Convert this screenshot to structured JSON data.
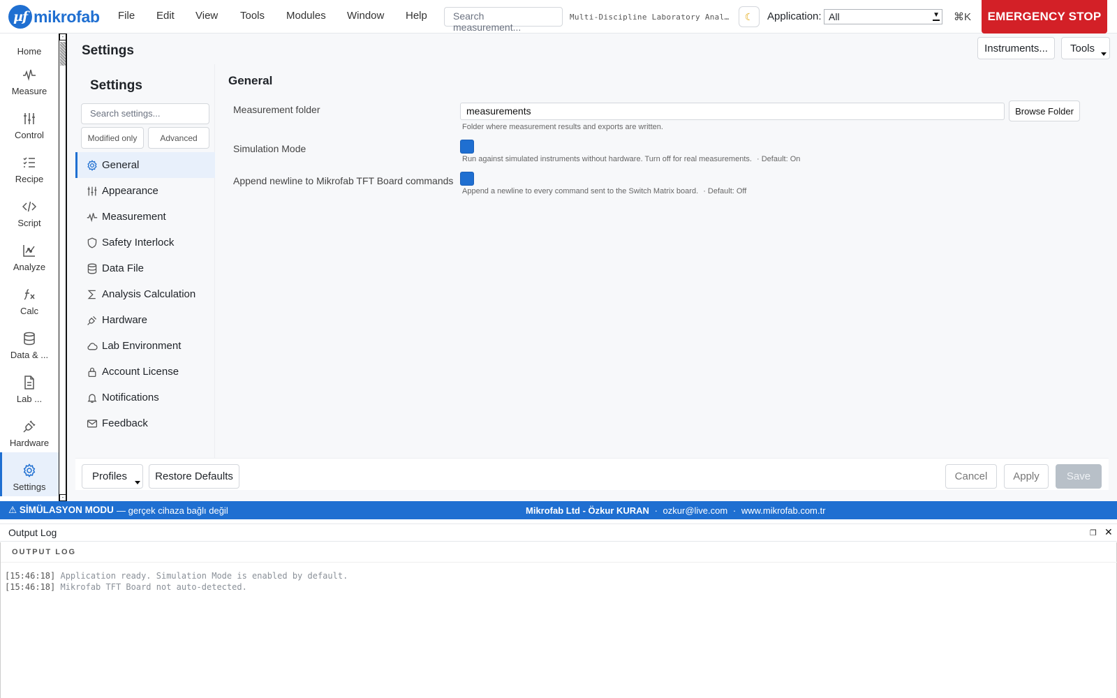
{
  "app": {
    "logo_mark": "µf",
    "logo_text": "mikrofab",
    "title": "Multi-Discipline Laboratory Analysis"
  },
  "menu": [
    "File",
    "Edit",
    "View",
    "Tools",
    "Modules",
    "Window",
    "Help"
  ],
  "search": {
    "placeholder": "Search measurement..."
  },
  "theme_icon": "moon-icon",
  "application": {
    "label": "Application:",
    "value": "All"
  },
  "shortcut": "⌘K",
  "emergency_stop": "EMERGENCY STOP",
  "rail": [
    {
      "label": "Home",
      "icon": "home-icon"
    },
    {
      "label": "Measure",
      "icon": "waveform-icon"
    },
    {
      "label": "Control",
      "icon": "sliders-icon"
    },
    {
      "label": "Recipe",
      "icon": "list-icon"
    },
    {
      "label": "Script",
      "icon": "code-icon"
    },
    {
      "label": "Analyze",
      "icon": "chart-icon"
    },
    {
      "label": "Calc",
      "icon": "function-icon"
    },
    {
      "label": "Data & ...",
      "icon": "database-icon"
    },
    {
      "label": "Lab ...",
      "icon": "document-icon"
    },
    {
      "label": "Hardware",
      "icon": "plug-icon"
    },
    {
      "label": "Settings",
      "icon": "gear-icon",
      "active": true
    }
  ],
  "page": {
    "title": "Settings",
    "instruments_button": "Instruments...",
    "tools_button": "Tools"
  },
  "settings": {
    "title": "Settings",
    "search_placeholder": "Search settings...",
    "filter_modified": "Modified only",
    "filter_advanced": "Advanced",
    "nav": [
      {
        "label": "General",
        "icon": "gear-icon",
        "active": true
      },
      {
        "label": "Appearance",
        "icon": "sliders-icon"
      },
      {
        "label": "Measurement",
        "icon": "waveform-icon"
      },
      {
        "label": "Safety Interlock",
        "icon": "shield-icon"
      },
      {
        "label": "Data File",
        "icon": "database-icon"
      },
      {
        "label": "Analysis Calculation",
        "icon": "sigma-icon"
      },
      {
        "label": "Hardware",
        "icon": "plug-icon"
      },
      {
        "label": "Lab Environment",
        "icon": "cloud-icon"
      },
      {
        "label": "Account License",
        "icon": "lock-icon"
      },
      {
        "label": "Notifications",
        "icon": "bell-icon"
      },
      {
        "label": "Feedback",
        "icon": "mail-icon"
      }
    ],
    "section_title": "General",
    "fields": {
      "folder_label": "Measurement folder",
      "folder_value": "measurements",
      "browse_button": "Browse Folder",
      "folder_hint": "Folder where measurement results and exports are written.",
      "sim_label": "Simulation Mode",
      "sim_checked": true,
      "sim_hint": "Run against simulated instruments without hardware. Turn off for real measurements.",
      "sim_default": "· Default: On",
      "newline_label": "Append newline to Mikrofab TFT Board commands",
      "newline_checked": true,
      "newline_hint": "Append a newline to every command sent to the Switch Matrix board.",
      "newline_default": "· Default: Off"
    },
    "footer": {
      "profiles": "Profiles",
      "restore": "Restore Defaults",
      "cancel": "Cancel",
      "apply": "Apply",
      "save": "Save"
    }
  },
  "status": {
    "badge": "⚠ SİMÜLASYON MODU",
    "note": "— gerçek cihaza bağlı değil",
    "company": "Mikrofab Ltd - Özkur KURAN",
    "email": "ozkur@live.com",
    "website": "www.mikrofab.com.tr",
    "separator": "·"
  },
  "log": {
    "dock_title": "Output Log",
    "label": "OUTPUT LOG",
    "lines": [
      {
        "ts": "[15:46:18]",
        "msg": "Application ready. Simulation Mode is enabled by default."
      },
      {
        "ts": "[15:46:18]",
        "msg": "Mikrofab TFT Board not auto-detected."
      }
    ]
  }
}
